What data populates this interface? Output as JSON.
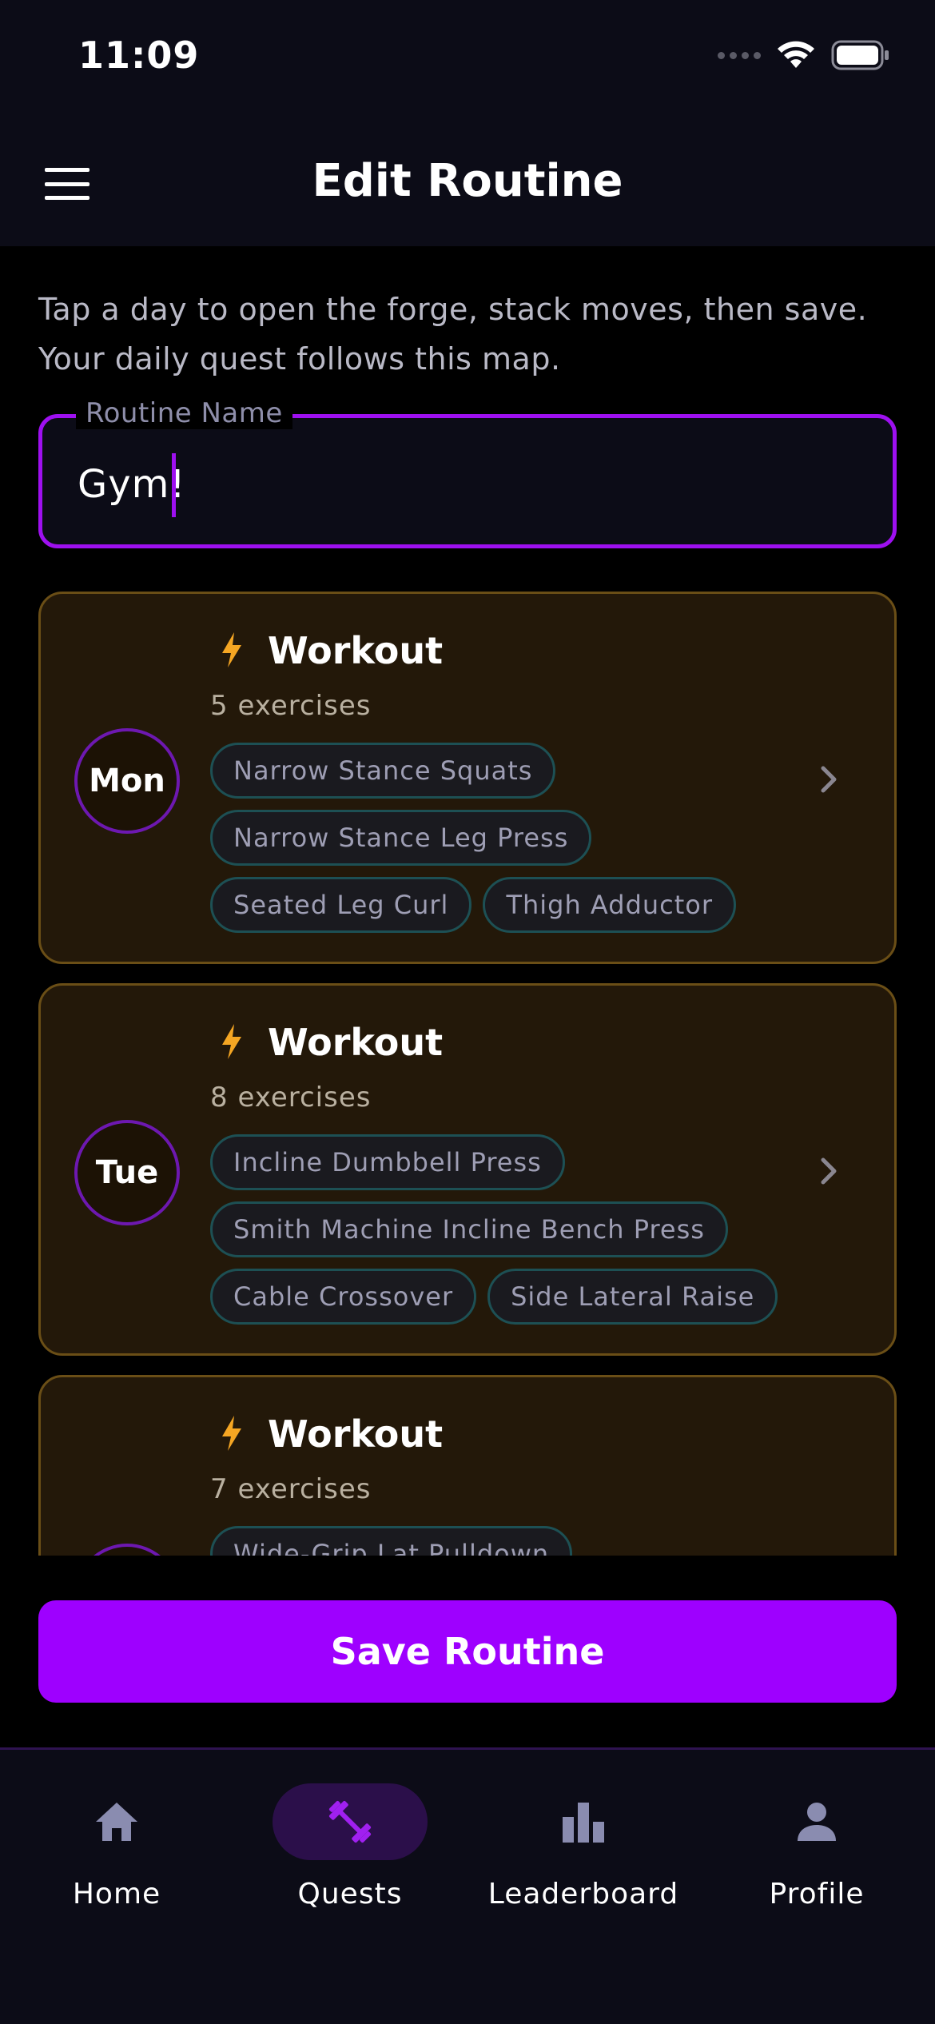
{
  "status_bar": {
    "time": "11:09"
  },
  "header": {
    "title": "Edit Routine",
    "menu_icon": "hamburger-menu-icon"
  },
  "intro": {
    "line1": "Tap a day to open the forge, stack moves, then save.",
    "line2": "Your daily quest follows this map."
  },
  "routine_name": {
    "label": "Routine Name",
    "value": "Gym!"
  },
  "days": [
    {
      "day": "Mon",
      "title": "Workout",
      "count": "5 exercises",
      "exercises": [
        "Narrow Stance Squats",
        "Narrow Stance Leg Press",
        "Seated Leg Curl",
        "Thigh Adductor"
      ]
    },
    {
      "day": "Tue",
      "title": "Workout",
      "count": "8 exercises",
      "exercises": [
        "Incline Dumbbell Press",
        "Smith Machine Incline Bench Press",
        "Cable Crossover",
        "Side Lateral Raise"
      ]
    },
    {
      "day": "",
      "title": "Workout",
      "count": "7 exercises",
      "exercises": [
        "Wide-Grip Lat Pulldown"
      ]
    }
  ],
  "save_button": {
    "label": "Save Routine"
  },
  "nav": [
    {
      "label": "Home",
      "icon": "home-icon",
      "active": false
    },
    {
      "label": "Quests",
      "icon": "dumbbell-icon",
      "active": true
    },
    {
      "label": "Leaderboard",
      "icon": "bar-chart-icon",
      "active": false
    },
    {
      "label": "Profile",
      "icon": "person-icon",
      "active": false
    }
  ],
  "colors": {
    "accent": "#9e00ff",
    "card_bg": "#231809",
    "card_border": "#6a4e16",
    "bolt": "#f5a623",
    "nav_active_bg": "#2b0f4a"
  }
}
